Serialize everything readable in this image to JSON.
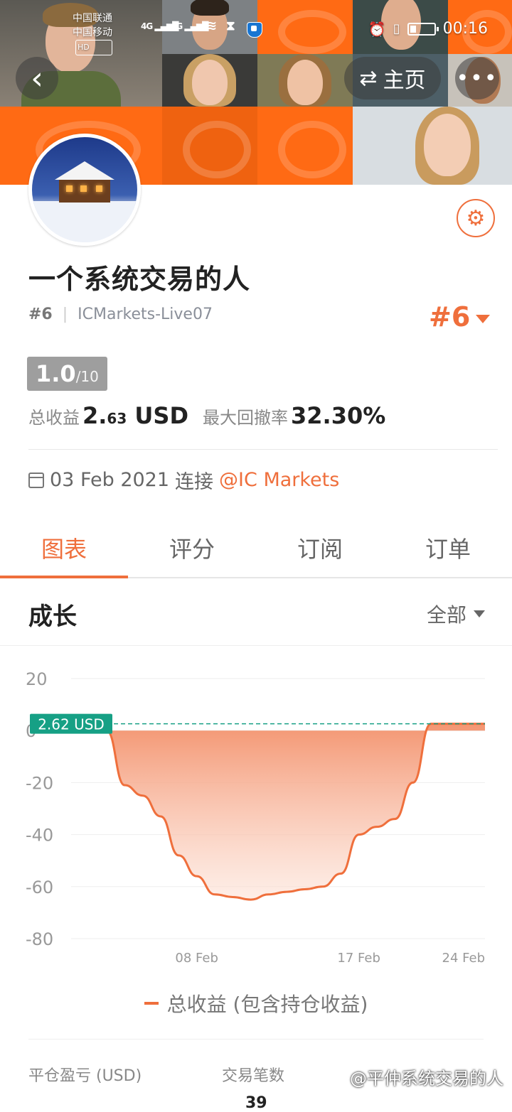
{
  "status_bar": {
    "carrier1": "中国联通",
    "carrier2": "中国移动",
    "hd": "HD",
    "net1": "4G",
    "net2": "4G",
    "time": "00:16"
  },
  "nav": {
    "back_icon": "‹",
    "home_label": "主页",
    "home_icon": "⇄",
    "more_icon": "•••"
  },
  "profile": {
    "name": "一个系统交易的人",
    "rank_small": "#6",
    "account": "ICMarkets-Live07",
    "rank_big": "#6",
    "score": "1.0",
    "score_max": "/10",
    "profit_label": "总收益",
    "profit_value_main": "2.",
    "profit_value_small": "63",
    "profit_unit": "USD",
    "drawdown_label": "最大回撤率",
    "drawdown_value": "32.30%",
    "date": "03 Feb 2021",
    "connect_label": "连接",
    "broker": "@IC Markets",
    "accent_color": "#ef6f3c"
  },
  "tabs": [
    {
      "label": "图表",
      "active": true
    },
    {
      "label": "评分",
      "active": false
    },
    {
      "label": "订阅",
      "active": false
    },
    {
      "label": "订单",
      "active": false
    }
  ],
  "growth": {
    "title": "成长",
    "filter": "全部"
  },
  "chart_data": {
    "type": "area",
    "ylim": [
      -80,
      20
    ],
    "y_ticks": [
      "20",
      "0",
      "-20",
      "-40",
      "-60",
      "-80"
    ],
    "x_tick_labels": [
      "08 Feb",
      "17 Feb",
      "24 Feb"
    ],
    "x": [
      "03 Feb",
      "04 Feb",
      "05 Feb",
      "06 Feb",
      "07 Feb",
      "08 Feb",
      "09 Feb",
      "10 Feb",
      "11 Feb",
      "12 Feb",
      "13 Feb",
      "14 Feb",
      "15 Feb",
      "16 Feb",
      "17 Feb",
      "18 Feb",
      "19 Feb",
      "20 Feb",
      "21 Feb",
      "22 Feb",
      "23 Feb",
      "24 Feb"
    ],
    "series": [
      {
        "name": "总收益 (包含持仓收益)",
        "values": [
          0,
          -21,
          -25,
          -33,
          -48,
          -56,
          -63,
          -64,
          -65,
          -63,
          -62,
          -61,
          -60,
          -55,
          -40,
          -37,
          -34,
          -20,
          2.62,
          2.62,
          2.62,
          2.62
        ]
      }
    ],
    "current_label": "2.62 USD",
    "current_value": 2.62,
    "line_color": "#ef6f3c",
    "label_color": "#16a085"
  },
  "bottom_stats": {
    "closed_pl_label": "平仓盈亏 (USD)",
    "trades_label": "交易笔数",
    "trades_value": "39"
  },
  "watermark": "@平仲系统交易的人"
}
